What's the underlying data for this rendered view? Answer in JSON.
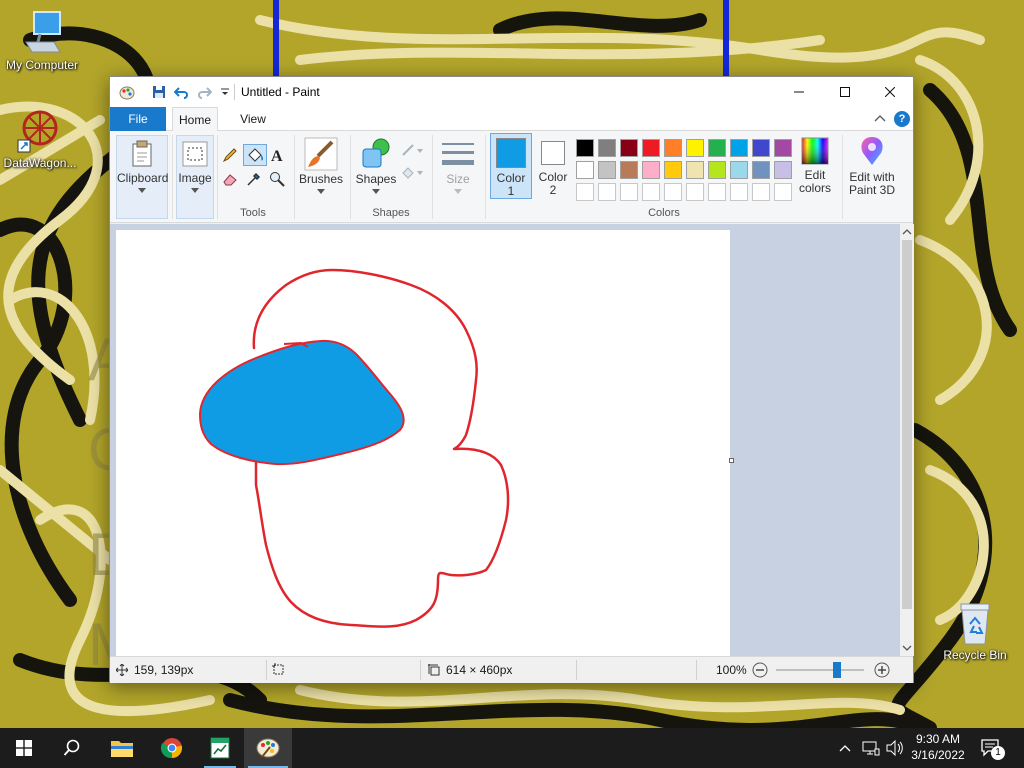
{
  "desktop": {
    "icons": [
      {
        "label": "My Computer"
      },
      {
        "label": "DataWagon..."
      },
      {
        "label": "Recycle Bin"
      }
    ]
  },
  "window": {
    "title": "Untitled - Paint",
    "tabs": {
      "file": "File",
      "home": "Home",
      "view": "View"
    }
  },
  "ribbon": {
    "clipboard": {
      "label": "Clipboard"
    },
    "image": {
      "label": "Image"
    },
    "tools": {
      "group_label": "Tools"
    },
    "brushes": {
      "label": "Brushes"
    },
    "shapes": {
      "label": "Shapes",
      "group_label": "Shapes"
    },
    "size": {
      "label": "Size"
    },
    "color1": {
      "line1": "Color",
      "line2": "1",
      "value": "#0f9ce5"
    },
    "color2": {
      "line1": "Color",
      "line2": "2",
      "value": "#ffffff"
    },
    "colors_group_label": "Colors",
    "edit_colors": {
      "line1": "Edit",
      "line2": "colors"
    },
    "paint3d": {
      "line1": "Edit with",
      "line2": "Paint 3D"
    },
    "palette_row1": [
      "#000000",
      "#7f7f7f",
      "#880015",
      "#ed1c24",
      "#ff7f27",
      "#fff200",
      "#22b14c",
      "#00a2e8",
      "#3f48cc",
      "#a349a4"
    ],
    "palette_row2": [
      "#ffffff",
      "#c3c3c3",
      "#b97a57",
      "#ffaec9",
      "#ffc90e",
      "#efe4b0",
      "#b5e61d",
      "#99d9ea",
      "#7092be",
      "#c8bfe7"
    ]
  },
  "drawing": {
    "stroke_color": "#e0262d",
    "fill_color": "#0f9ce5"
  },
  "status": {
    "cursor_pos": "159, 139px",
    "selection_size": "",
    "canvas_size": "614 × 460px",
    "zoom": "100%",
    "zoom_level": 0.5
  },
  "taskbar": {
    "time": "9:30 AM",
    "date": "3/16/2022",
    "notification_count": "1"
  }
}
